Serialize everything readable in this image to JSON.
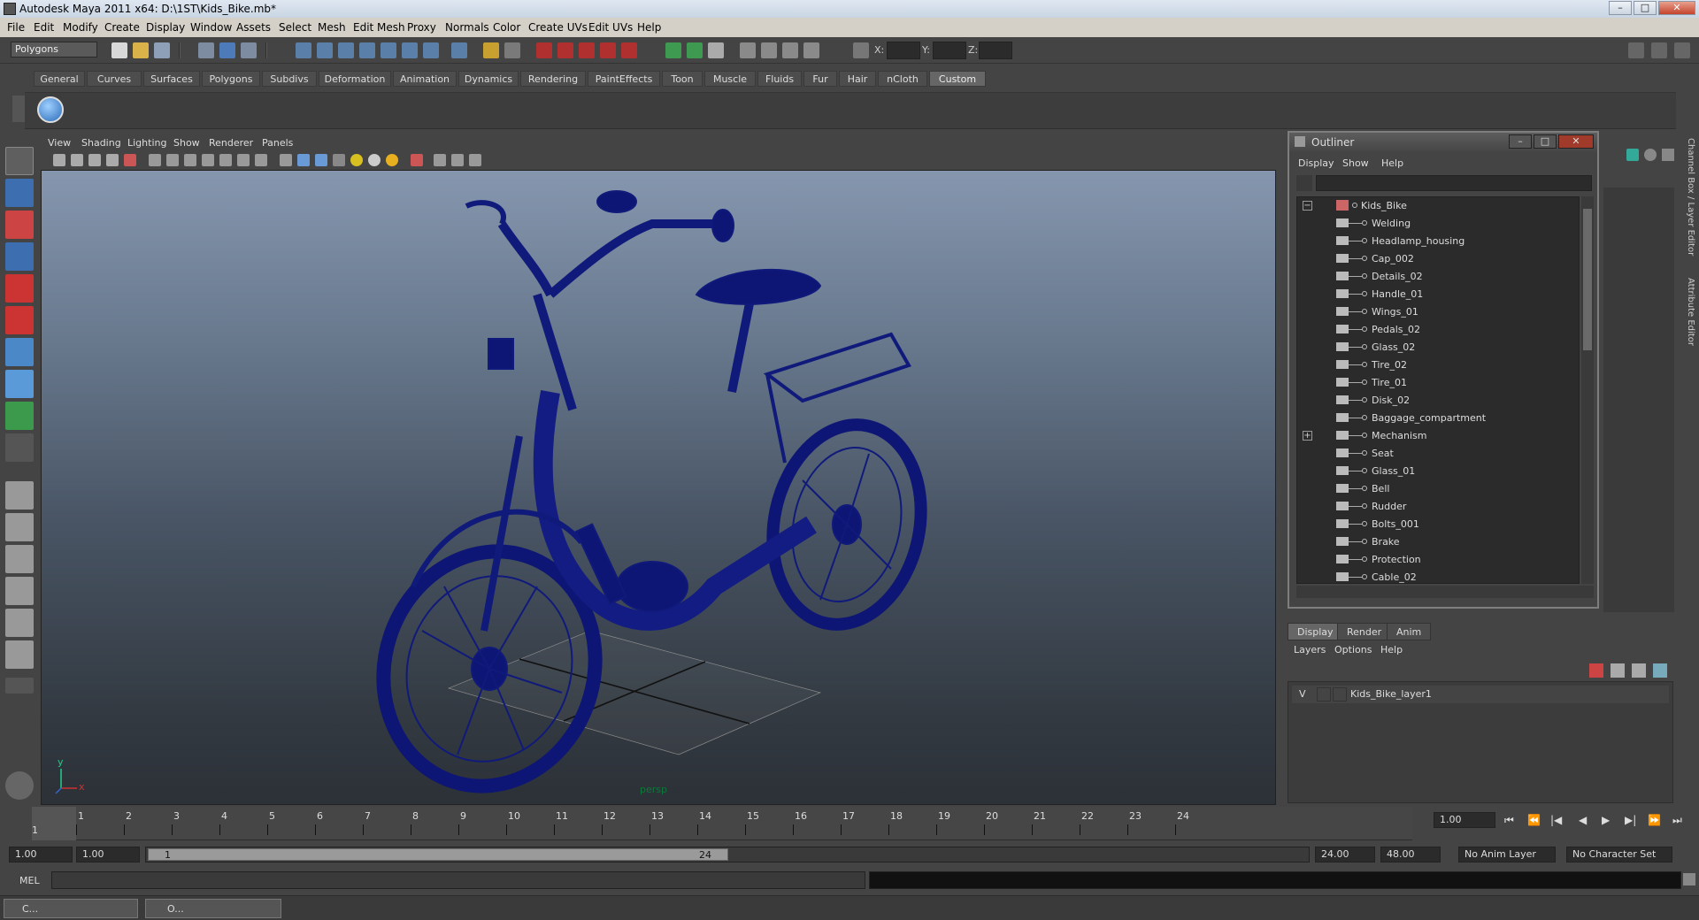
{
  "window": {
    "title": "Autodesk Maya 2011 x64: D:\\1ST\\Kids_Bike.mb*",
    "min": "–",
    "max": "□",
    "close": "✕"
  },
  "menubar": [
    "File",
    "Edit",
    "Modify",
    "Create",
    "Display",
    "Window",
    "Assets",
    "Select",
    "Mesh",
    "Edit Mesh",
    "Proxy",
    "Normals",
    "Color",
    "Create UVs",
    "Edit UVs",
    "Help"
  ],
  "statusline": {
    "mode": "Polygons",
    "x_label": "X:",
    "y_label": "Y:",
    "z_label": "Z:"
  },
  "shelf_tabs": [
    "General",
    "Curves",
    "Surfaces",
    "Polygons",
    "Subdivs",
    "Deformation",
    "Animation",
    "Dynamics",
    "Rendering",
    "PaintEffects",
    "Toon",
    "Muscle",
    "Fluids",
    "Fur",
    "Hair",
    "nCloth",
    "Custom"
  ],
  "shelf_active": "Custom",
  "panel_menu": [
    "View",
    "Shading",
    "Lighting",
    "Show",
    "Renderer",
    "Panels"
  ],
  "viewport": {
    "camera": "persp",
    "axis_x": "x",
    "axis_y": "y"
  },
  "outliner": {
    "title": "Outliner",
    "menu": [
      "Display",
      "Show",
      "Help"
    ],
    "root": "Kids_Bike",
    "items": [
      "Welding",
      "Headlamp_housing",
      "Cap_002",
      "Details_02",
      "Handle_01",
      "Wings_01",
      "Pedals_02",
      "Glass_02",
      "Tire_02",
      "Tire_01",
      "Disk_02",
      "Baggage_compartment",
      "Mechanism",
      "Seat",
      "Glass_01",
      "Bell",
      "Rudder",
      "Bolts_001",
      "Brake",
      "Protection",
      "Cable_02"
    ],
    "expand_minus": "−",
    "expand_plus": "+"
  },
  "layer_editor": {
    "tabs": [
      "Display",
      "Render",
      "Anim"
    ],
    "active_tab": "Display",
    "menu": [
      "Layers",
      "Options",
      "Help"
    ],
    "layer": {
      "visible": "V",
      "name": "Kids_Bike_layer1"
    }
  },
  "side_tabs": [
    "Channel Box / Layer Editor",
    "Attribute Editor"
  ],
  "timeslider": {
    "frames": [
      "1",
      "2",
      "3",
      "4",
      "5",
      "6",
      "7",
      "8",
      "9",
      "10",
      "11",
      "12",
      "13",
      "14",
      "15",
      "16",
      "17",
      "18",
      "19",
      "20",
      "21",
      "22",
      "23",
      "24"
    ],
    "current_start_marker": "1",
    "current_frame": "1.00",
    "playback": [
      "⏮",
      "⏪",
      "|◀",
      "◀",
      "▶",
      "▶|",
      "⏩",
      "⏭"
    ]
  },
  "range": {
    "start": "1.00",
    "playback_start": "1.00",
    "handle_start": "1",
    "handle_end": "24",
    "playback_end": "24.00",
    "end": "48.00",
    "anim_layer": "No Anim Layer",
    "character_set": "No Character Set"
  },
  "cmdline": {
    "label": "MEL"
  },
  "taskbar": [
    {
      "label": "C..."
    },
    {
      "label": "O..."
    }
  ]
}
